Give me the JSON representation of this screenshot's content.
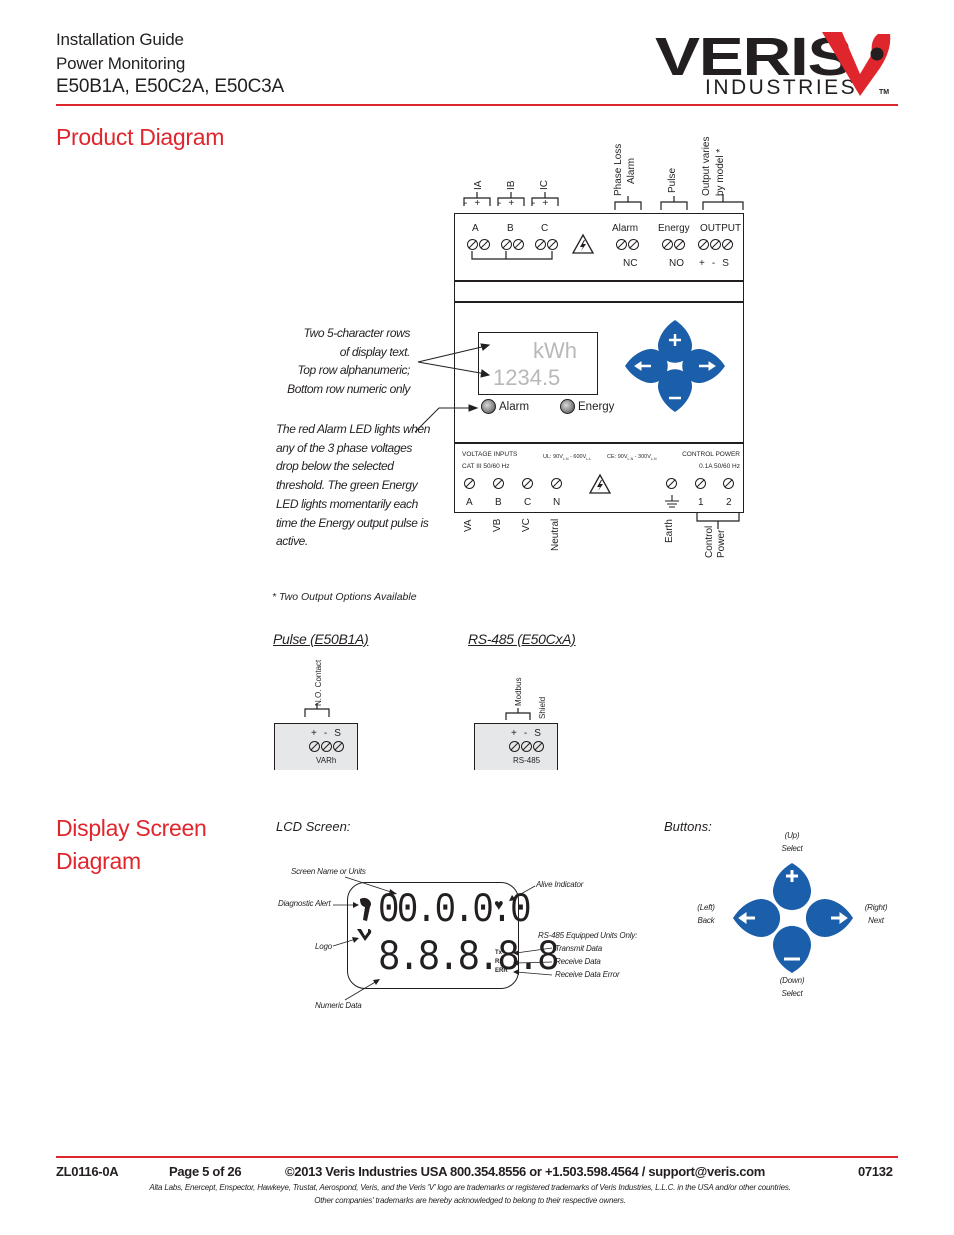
{
  "header": {
    "line1": "Installation Guide",
    "line2": "Power Monitoring",
    "models": "E50B1A, E50C2A, E50C3A",
    "logo": {
      "brand": "VERIS",
      "sub": "INDUSTRIES",
      "tm": "TM"
    },
    "accent_color": "#e0262d"
  },
  "product_diagram": {
    "title": "Product Diagram",
    "top_terminals": {
      "current_inputs": [
        {
          "group": "IA",
          "label": "A",
          "polarity": [
            "-",
            "+"
          ]
        },
        {
          "group": "IB",
          "label": "B",
          "polarity": [
            "-",
            "+"
          ]
        },
        {
          "group": "IC",
          "label": "C",
          "polarity": [
            "-",
            "+"
          ]
        }
      ],
      "alarm": {
        "group": "Phase Loss Alarm",
        "group_line1": "Phase Loss",
        "group_line2": "Alarm",
        "label": "Alarm",
        "sub": "NC"
      },
      "energy": {
        "group": "Pulse",
        "label": "Energy",
        "sub": "NO"
      },
      "output": {
        "group_line1": "Output varies",
        "group_line2": "by model *",
        "label": "OUTPUT",
        "pins": [
          "+",
          "-",
          "S"
        ]
      }
    },
    "display": {
      "top_row": "kWh",
      "bottom_row": "1234.5"
    },
    "leds": [
      {
        "label": "Alarm",
        "color": "red"
      },
      {
        "label": "Energy",
        "color": "green"
      }
    ],
    "buttons": [
      {
        "name": "up",
        "glyph": "+"
      },
      {
        "name": "left",
        "glyph": "←"
      },
      {
        "name": "right",
        "glyph": "→"
      },
      {
        "name": "down",
        "glyph": "−"
      }
    ],
    "button_color": "#1b5faa",
    "bottom_terminals": {
      "voltage_title": "VOLTAGE INPUTS",
      "voltage_cat": "CAT III  50/60 Hz",
      "ul_rating": "UL: 90V L-N - 600V L-L",
      "ul_main": "UL: 90V",
      "ul_sub1": "L-N",
      "ul_mid": " - 600V",
      "ul_sub2": "L-L",
      "ce_main": "CE: 90V",
      "ce_sub1": "L-N",
      "ce_mid": " - 300V",
      "ce_sub2": "L-N",
      "control_title": "CONTROL POWER",
      "control_rating": "0.1A  50/60 Hz",
      "voltage_pins": [
        "A",
        "B",
        "C",
        "N"
      ],
      "control_pins": [
        "1",
        "2"
      ],
      "voltage_labels": [
        "VA",
        "VB",
        "VC",
        "Neutral"
      ],
      "earth_label": "Earth",
      "control_power_line1": "Control",
      "control_power_line2": "Power"
    },
    "notes": {
      "display": [
        "Two 5-character rows",
        "of display text.",
        "Top row alphanumeric;",
        "Bottom row numeric only"
      ],
      "leds": [
        "The red Alarm LED lights when",
        "any of the 3 phase voltages",
        "drop below the selected",
        "threshold.  The green Energy",
        "LED lights momentarily each",
        "time the Energy output pulse is",
        "active."
      ]
    },
    "output_options_note": "* Two Output Options Available",
    "output_options": [
      {
        "title": "Pulse (E50B1A)",
        "group_label": "N.O. Contact",
        "pins": [
          "+",
          "-",
          "S"
        ],
        "caption": "VARh"
      },
      {
        "title": "RS-485 (E50CxA)",
        "group_label": "Modbus",
        "extra_label": "Shield",
        "pins": [
          "+",
          "-",
          "S"
        ],
        "caption": "RS-485"
      }
    ]
  },
  "display_screen_diagram": {
    "title_line1": "Display Screen",
    "title_line2": "Diagram",
    "lcd": {
      "heading": "LCD Screen:",
      "top_digits": "00.0.0.0",
      "bottom_digits": "8.8.8.8.8",
      "indicators": [
        "Tx",
        "Rx",
        "ERR"
      ],
      "callouts": {
        "screen_name": "Screen Name or Units",
        "diagnostic": "Diagnostic Alert",
        "logo": "Logo",
        "numeric": "Numeric Data",
        "alive": "Alive Indicator",
        "rs485": "RS-485 Equipped Units Only:",
        "tx": "Transmit Data",
        "rx": "Receive Data",
        "err": "Receive Data Error"
      }
    },
    "buttons": {
      "heading": "Buttons:",
      "up": [
        "(Up)",
        "Select"
      ],
      "left": [
        "(Left)",
        "Back"
      ],
      "right": [
        "(Right)",
        "Next"
      ],
      "down": [
        "(Down)",
        "Select"
      ]
    }
  },
  "footer": {
    "doc_id": "ZL0116-0A",
    "page": "Page 5 of 26",
    "contact": "©2013 Veris Industries   USA 800.354.8556 or +1.503.598.4564  / support@veris.com",
    "code": "07132",
    "trademark1": "Alta Labs, Enercept, Enspector, Hawkeye, Trustat, Aerospond, Veris, and the Veris 'V' logo are trademarks or registered trademarks of  Veris Industries, L.L.C. in the USA and/or other countries.",
    "trademark2": "Other companies' trademarks are hereby acknowledged to belong to their respective owners."
  }
}
